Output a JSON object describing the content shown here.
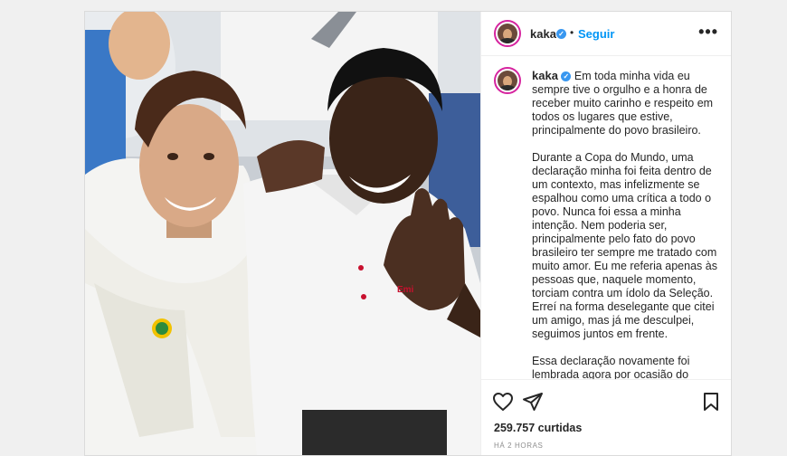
{
  "post": {
    "username": "kaka",
    "follow_label": "Seguir",
    "more_label": "•••",
    "photo_shirt_text": "Emi",
    "caption_paragraphs": [
      "Em toda minha vida eu sempre tive o orgulho e a honra de receber muito carinho e respeito em todos os lugares que estive, principalmente do povo brasileiro.",
      "Durante a Copa do Mundo, uma declaração minha foi feita dentro de um contexto, mas infelizmente se espalhou como uma crítica a todo o povo. Nunca foi essa a minha intenção. Nem poderia ser, principalmente pelo fato do povo brasileiro ter sempre me tratado com muito amor. Eu me referia apenas às pessoas que, naquele momento, torciam contra um ídolo da Seleção. Erreí na forma deselegante que citei um amigo, mas já me desculpei, seguimos juntos em frente.",
      "Essa declaração novamente foi lembrada agora por ocasião do"
    ],
    "likes": "259.757 curtidas",
    "timestamp": "HÁ 2 HORAS"
  },
  "icons": {
    "like": "heart-icon",
    "share": "paper-plane-icon",
    "save": "bookmark-icon",
    "verified": "verified-badge-icon",
    "more": "more-dots-icon"
  },
  "colors": {
    "follow": "#0095f6",
    "verified": "#3897f0",
    "shirt_accent": "#c8102e"
  }
}
